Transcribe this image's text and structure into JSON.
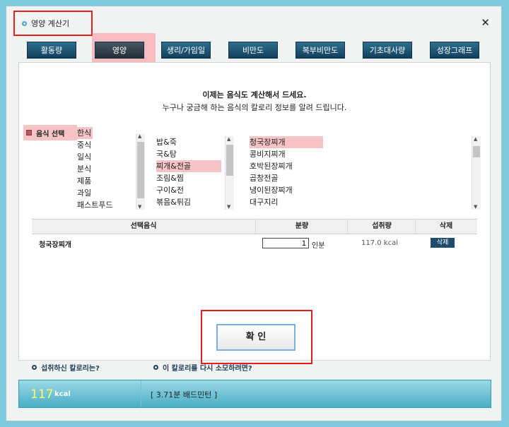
{
  "window": {
    "title": "영양 계산기",
    "close_glyph": "✕"
  },
  "tabs": [
    {
      "label": "활동량"
    },
    {
      "label": "영양",
      "active": true
    },
    {
      "label": "생리/가임일"
    },
    {
      "label": "비만도"
    },
    {
      "label": "복부비만도"
    },
    {
      "label": "기초대사량"
    },
    {
      "label": "성장그래프"
    }
  ],
  "intro": {
    "line1": "이제는 음식도 계산해서 드세요.",
    "line2": "누구나 궁금해 하는 음식의 칼로리 정보를 알려 드립니다."
  },
  "food_select_label": "음식 선택",
  "cuisines": [
    "한식",
    "중식",
    "일식",
    "분식",
    "제품",
    "과일",
    "패스트푸드"
  ],
  "categories": [
    "밥&죽",
    "국&탕",
    "찌개&전골",
    "조림&찜",
    "구이&전",
    "볶음&튀김"
  ],
  "dishes": [
    "청국장찌개",
    "콩비지찌개",
    "호박된장찌개",
    "곱창전골",
    "냉이된장찌개",
    "대구지리"
  ],
  "selected": {
    "cuisine": "한식",
    "category": "찌개&전골",
    "dish": "청국장찌개"
  },
  "table": {
    "headers": {
      "food": "선택음식",
      "qty": "분량",
      "kcal": "섭취량",
      "del": "삭제"
    },
    "rows": [
      {
        "food": "청국장찌개",
        "qty": "1",
        "unit": "인분",
        "kcal": "117.0 kcal",
        "del": "삭제"
      }
    ]
  },
  "confirm_label": "확 인",
  "footer": {
    "link1": "섭취하신 칼로리는?",
    "link2": "이 칼로리를 다시 소모하려면?",
    "kcal_value": "117",
    "kcal_unit": "kcal",
    "burn_text": "[ 3.71분  배드민턴 ]"
  },
  "colors": {
    "background": "#7ec9dc",
    "tab": "#1d5a7a",
    "highlight": "#f6c4c7",
    "annotation": "#e02020"
  }
}
